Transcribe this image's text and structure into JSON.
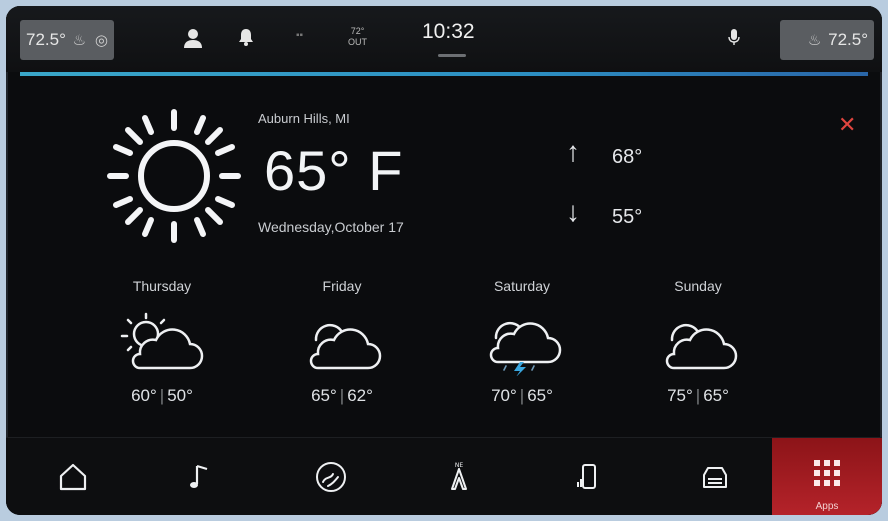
{
  "status_bar": {
    "driver_temp": "72.5°",
    "passenger_temp": "72.5°",
    "outside_temp_top": "72°",
    "outside_temp_bottom": "OUT",
    "clock": "10:32"
  },
  "weather": {
    "location": "Auburn Hills, MI",
    "current_temp": "65° F",
    "date": "Wednesday,October 17",
    "high": "68°",
    "low": "55°",
    "current_icon": "sun-icon"
  },
  "forecast": [
    {
      "day": "Thursday",
      "high": "60°",
      "low": "50°",
      "icon": "partly-sunny-icon"
    },
    {
      "day": "Friday",
      "high": "65°",
      "low": "62°",
      "icon": "partly-cloudy-icon"
    },
    {
      "day": "Saturday",
      "high": "70°",
      "low": "65°",
      "icon": "thunderstorm-icon"
    },
    {
      "day": "Sunday",
      "high": "75°",
      "low": "65°",
      "icon": "partly-cloudy-icon"
    }
  ],
  "nav": {
    "items": [
      "home-icon",
      "music-icon",
      "climate-icon",
      "navigation-icon",
      "phone-icon",
      "vehicle-icon",
      "apps-icon"
    ],
    "apps_label": "Apps"
  },
  "colors": {
    "accent_line": "#2c8fc2",
    "close": "#e0453f",
    "apps_bg": "#b5232a"
  }
}
